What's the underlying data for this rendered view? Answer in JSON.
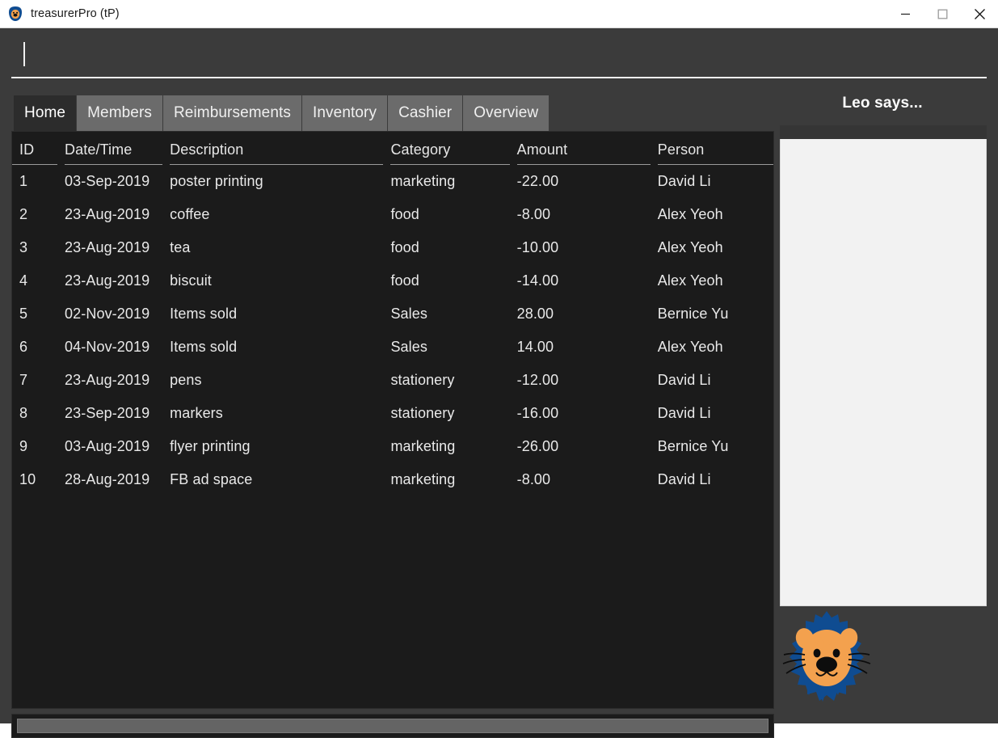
{
  "window": {
    "title": "treasurerPro (tP)",
    "icon": "lion-head-icon",
    "controls": {
      "minimize": "minimize-icon",
      "maximize": "maximize-icon",
      "close": "close-icon"
    }
  },
  "command": {
    "value": "",
    "placeholder": ""
  },
  "tabs": [
    {
      "label": "Home",
      "active": true
    },
    {
      "label": "Members",
      "active": false
    },
    {
      "label": "Reimbursements",
      "active": false
    },
    {
      "label": "Inventory",
      "active": false
    },
    {
      "label": "Cashier",
      "active": false
    },
    {
      "label": "Overview",
      "active": false
    }
  ],
  "table": {
    "columns": [
      "ID",
      "Date/Time",
      "Description",
      "Category",
      "Amount",
      "Person"
    ],
    "rows": [
      {
        "id": "1",
        "date": "03-Sep-2019",
        "description": "poster printing",
        "category": "marketing",
        "amount": "-22.00",
        "person": "David Li"
      },
      {
        "id": "2",
        "date": "23-Aug-2019",
        "description": "coffee",
        "category": "food",
        "amount": "-8.00",
        "person": "Alex Yeoh"
      },
      {
        "id": "3",
        "date": "23-Aug-2019",
        "description": "tea",
        "category": "food",
        "amount": "-10.00",
        "person": "Alex Yeoh"
      },
      {
        "id": "4",
        "date": "23-Aug-2019",
        "description": "biscuit",
        "category": "food",
        "amount": "-14.00",
        "person": "Alex Yeoh"
      },
      {
        "id": "5",
        "date": "02-Nov-2019",
        "description": "Items sold",
        "category": "Sales",
        "amount": "28.00",
        "person": "Bernice Yu"
      },
      {
        "id": "6",
        "date": "04-Nov-2019",
        "description": "Items sold",
        "category": "Sales",
        "amount": "14.00",
        "person": "Alex Yeoh"
      },
      {
        "id": "7",
        "date": "23-Aug-2019",
        "description": "pens",
        "category": "stationery",
        "amount": "-12.00",
        "person": "David Li"
      },
      {
        "id": "8",
        "date": "23-Sep-2019",
        "description": "markers",
        "category": "stationery",
        "amount": "-16.00",
        "person": "David Li"
      },
      {
        "id": "9",
        "date": "03-Aug-2019",
        "description": "flyer printing",
        "category": "marketing",
        "amount": "-26.00",
        "person": "Bernice Yu"
      },
      {
        "id": "10",
        "date": "28-Aug-2019",
        "description": "FB ad space",
        "category": "marketing",
        "amount": "-8.00",
        "person": "David Li"
      }
    ]
  },
  "right_panel": {
    "title": "Leo says...",
    "result_text": "",
    "mascot": "lion-mascot-icon"
  },
  "colors": {
    "window_bg": "#3b3b3b",
    "panel_bg": "#1b1b1b",
    "tab_active": "#2c2c2c",
    "tab_inactive": "#6b6b6b",
    "text": "#e9e9e9",
    "result_bg": "#f2f2f2",
    "mascot_mane": "#0f4c91",
    "mascot_face": "#f5a košt"
  }
}
